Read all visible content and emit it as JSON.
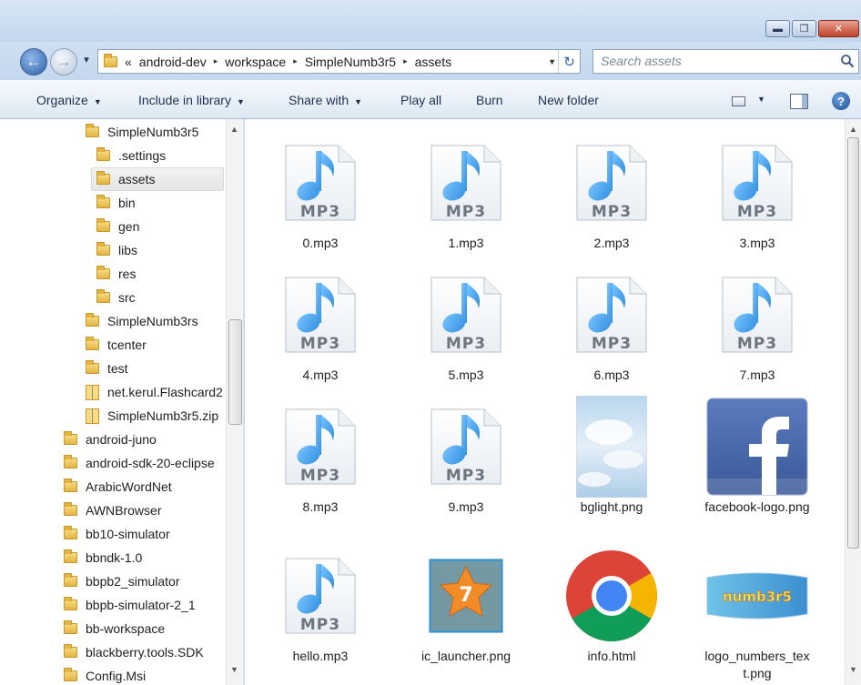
{
  "window": {
    "controls": [
      {
        "name": "minimize-button",
        "glyph": "▬"
      },
      {
        "name": "maximize-button",
        "glyph": "❐"
      },
      {
        "name": "close-button",
        "glyph": "✕"
      }
    ]
  },
  "address": {
    "chevron": "«",
    "crumbs": [
      "android-dev",
      "workspace",
      "SimpleNumb3r5",
      "assets"
    ],
    "separator": "▸"
  },
  "search": {
    "placeholder": "Search assets"
  },
  "toolbar": {
    "organize": "Organize",
    "include_in_library": "Include in library",
    "share_with": "Share with",
    "play_all": "Play all",
    "burn": "Burn",
    "new_folder": "New folder",
    "help": "?"
  },
  "nav_tree": [
    {
      "label": "SimpleNumb3r5",
      "type": "folder",
      "level": 1
    },
    {
      "label": ".settings",
      "type": "folder",
      "level": 2
    },
    {
      "label": "assets",
      "type": "folder",
      "level": 2,
      "selected": true
    },
    {
      "label": "bin",
      "type": "folder",
      "level": 2
    },
    {
      "label": "gen",
      "type": "folder",
      "level": 2
    },
    {
      "label": "libs",
      "type": "folder",
      "level": 2
    },
    {
      "label": "res",
      "type": "folder",
      "level": 2
    },
    {
      "label": "src",
      "type": "folder",
      "level": 2
    },
    {
      "label": "SimpleNumb3rs",
      "type": "folder",
      "level": 1
    },
    {
      "label": "tcenter",
      "type": "folder",
      "level": 1
    },
    {
      "label": "test",
      "type": "folder",
      "level": 1
    },
    {
      "label": "net.kerul.Flashcard2",
      "type": "zip",
      "level": 1
    },
    {
      "label": "SimpleNumb3r5.zip",
      "type": "zip",
      "level": 1
    },
    {
      "label": "android-juno",
      "type": "folder",
      "level": 0
    },
    {
      "label": "android-sdk-20-eclipse",
      "type": "folder",
      "level": 0
    },
    {
      "label": "ArabicWordNet",
      "type": "folder",
      "level": 0
    },
    {
      "label": "AWNBrowser",
      "type": "folder",
      "level": 0
    },
    {
      "label": "bb10-simulator",
      "type": "folder",
      "level": 0
    },
    {
      "label": "bbndk-1.0",
      "type": "folder",
      "level": 0
    },
    {
      "label": "bbpb2_simulator",
      "type": "folder",
      "level": 0
    },
    {
      "label": "bbpb-simulator-2_1",
      "type": "folder",
      "level": 0
    },
    {
      "label": "bb-workspace",
      "type": "folder",
      "level": 0
    },
    {
      "label": "blackberry.tools.SDK",
      "type": "folder",
      "level": 0
    },
    {
      "label": "Config.Msi",
      "type": "folder",
      "level": 0
    }
  ],
  "mp3_badge": "MP3",
  "app_icon_badge": "7",
  "logo_text": "numb3r5",
  "files": [
    {
      "name": "0.mp3",
      "type": "mp3"
    },
    {
      "name": "1.mp3",
      "type": "mp3"
    },
    {
      "name": "2.mp3",
      "type": "mp3"
    },
    {
      "name": "3.mp3",
      "type": "mp3"
    },
    {
      "name": "4.mp3",
      "type": "mp3"
    },
    {
      "name": "5.mp3",
      "type": "mp3"
    },
    {
      "name": "6.mp3",
      "type": "mp3"
    },
    {
      "name": "7.mp3",
      "type": "mp3"
    },
    {
      "name": "8.mp3",
      "type": "mp3"
    },
    {
      "name": "9.mp3",
      "type": "mp3"
    },
    {
      "name": "bglight.png",
      "type": "sky"
    },
    {
      "name": "facebook-logo.png",
      "type": "facebook"
    },
    {
      "name": "hello.mp3",
      "type": "mp3"
    },
    {
      "name": "ic_launcher.png",
      "type": "launcher"
    },
    {
      "name": "info.html",
      "type": "chrome"
    },
    {
      "name": "logo_numbers_text.png",
      "type": "logo"
    }
  ],
  "colors": {
    "note_blue": "#2f8fe0",
    "folder_yellow": "#f2c94c",
    "facebook_blue": "#3b5998",
    "launcher_orange": "#f28c28"
  }
}
